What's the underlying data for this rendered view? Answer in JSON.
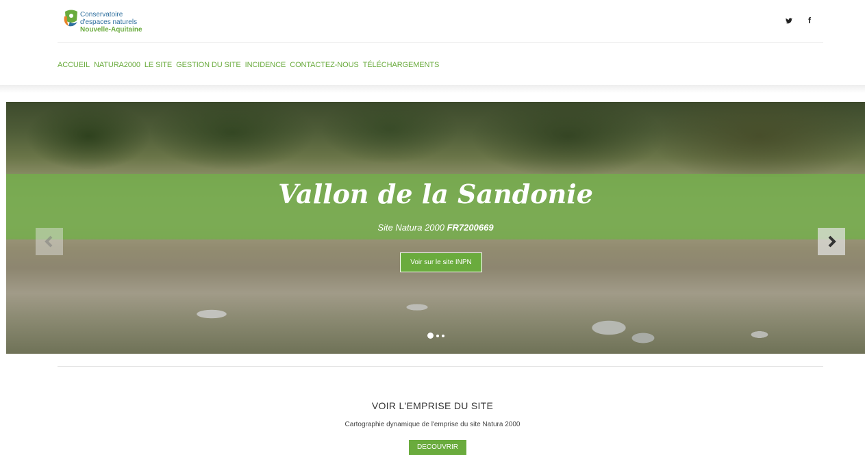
{
  "header": {
    "logo_line1": "Conservatoire",
    "logo_line2": "d'espaces naturels",
    "logo_line3": "Nouvelle-Aquitaine",
    "social": {
      "twitter": "•",
      "facebook": "f"
    }
  },
  "nav": {
    "items": [
      "ACCUEIL",
      "NATURA2000",
      "LE SITE",
      "GESTION DU SITE",
      "INCIDENCE",
      "CONTACTEZ-NOUS",
      "TÉLÉCHARGEMENTS"
    ]
  },
  "hero": {
    "title": "Vallon de la Sandonie",
    "subtitle_prefix": "Site Natura 2000 ",
    "subtitle_code": "FR7200669",
    "button_label": "Voir sur le site INPN",
    "slide_count": 3,
    "active_slide": 1
  },
  "section": {
    "title": "VOIR L'EMPRISE DU SITE",
    "description": "Cartographie dynamique de l'emprise du site Natura 2000",
    "button_label": "DECOUVRIR"
  },
  "colors": {
    "accent": "#6aab3d",
    "logo_blue": "#2e6f9e"
  }
}
